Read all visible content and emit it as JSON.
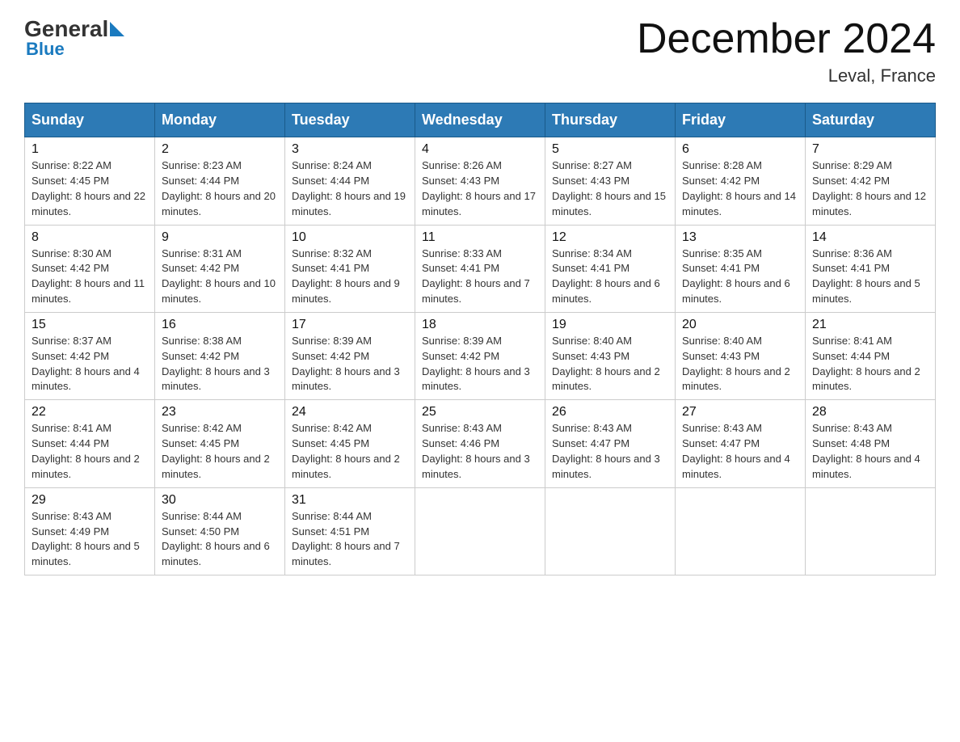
{
  "header": {
    "logo": {
      "general": "General",
      "blue": "Blue"
    },
    "month_title": "December 2024",
    "location": "Leval, France"
  },
  "weekdays": [
    "Sunday",
    "Monday",
    "Tuesday",
    "Wednesday",
    "Thursday",
    "Friday",
    "Saturday"
  ],
  "weeks": [
    [
      {
        "day": "1",
        "sunrise": "8:22 AM",
        "sunset": "4:45 PM",
        "daylight": "8 hours and 22 minutes."
      },
      {
        "day": "2",
        "sunrise": "8:23 AM",
        "sunset": "4:44 PM",
        "daylight": "8 hours and 20 minutes."
      },
      {
        "day": "3",
        "sunrise": "8:24 AM",
        "sunset": "4:44 PM",
        "daylight": "8 hours and 19 minutes."
      },
      {
        "day": "4",
        "sunrise": "8:26 AM",
        "sunset": "4:43 PM",
        "daylight": "8 hours and 17 minutes."
      },
      {
        "day": "5",
        "sunrise": "8:27 AM",
        "sunset": "4:43 PM",
        "daylight": "8 hours and 15 minutes."
      },
      {
        "day": "6",
        "sunrise": "8:28 AM",
        "sunset": "4:42 PM",
        "daylight": "8 hours and 14 minutes."
      },
      {
        "day": "7",
        "sunrise": "8:29 AM",
        "sunset": "4:42 PM",
        "daylight": "8 hours and 12 minutes."
      }
    ],
    [
      {
        "day": "8",
        "sunrise": "8:30 AM",
        "sunset": "4:42 PM",
        "daylight": "8 hours and 11 minutes."
      },
      {
        "day": "9",
        "sunrise": "8:31 AM",
        "sunset": "4:42 PM",
        "daylight": "8 hours and 10 minutes."
      },
      {
        "day": "10",
        "sunrise": "8:32 AM",
        "sunset": "4:41 PM",
        "daylight": "8 hours and 9 minutes."
      },
      {
        "day": "11",
        "sunrise": "8:33 AM",
        "sunset": "4:41 PM",
        "daylight": "8 hours and 7 minutes."
      },
      {
        "day": "12",
        "sunrise": "8:34 AM",
        "sunset": "4:41 PM",
        "daylight": "8 hours and 6 minutes."
      },
      {
        "day": "13",
        "sunrise": "8:35 AM",
        "sunset": "4:41 PM",
        "daylight": "8 hours and 6 minutes."
      },
      {
        "day": "14",
        "sunrise": "8:36 AM",
        "sunset": "4:41 PM",
        "daylight": "8 hours and 5 minutes."
      }
    ],
    [
      {
        "day": "15",
        "sunrise": "8:37 AM",
        "sunset": "4:42 PM",
        "daylight": "8 hours and 4 minutes."
      },
      {
        "day": "16",
        "sunrise": "8:38 AM",
        "sunset": "4:42 PM",
        "daylight": "8 hours and 3 minutes."
      },
      {
        "day": "17",
        "sunrise": "8:39 AM",
        "sunset": "4:42 PM",
        "daylight": "8 hours and 3 minutes."
      },
      {
        "day": "18",
        "sunrise": "8:39 AM",
        "sunset": "4:42 PM",
        "daylight": "8 hours and 3 minutes."
      },
      {
        "day": "19",
        "sunrise": "8:40 AM",
        "sunset": "4:43 PM",
        "daylight": "8 hours and 2 minutes."
      },
      {
        "day": "20",
        "sunrise": "8:40 AM",
        "sunset": "4:43 PM",
        "daylight": "8 hours and 2 minutes."
      },
      {
        "day": "21",
        "sunrise": "8:41 AM",
        "sunset": "4:44 PM",
        "daylight": "8 hours and 2 minutes."
      }
    ],
    [
      {
        "day": "22",
        "sunrise": "8:41 AM",
        "sunset": "4:44 PM",
        "daylight": "8 hours and 2 minutes."
      },
      {
        "day": "23",
        "sunrise": "8:42 AM",
        "sunset": "4:45 PM",
        "daylight": "8 hours and 2 minutes."
      },
      {
        "day": "24",
        "sunrise": "8:42 AM",
        "sunset": "4:45 PM",
        "daylight": "8 hours and 2 minutes."
      },
      {
        "day": "25",
        "sunrise": "8:43 AM",
        "sunset": "4:46 PM",
        "daylight": "8 hours and 3 minutes."
      },
      {
        "day": "26",
        "sunrise": "8:43 AM",
        "sunset": "4:47 PM",
        "daylight": "8 hours and 3 minutes."
      },
      {
        "day": "27",
        "sunrise": "8:43 AM",
        "sunset": "4:47 PM",
        "daylight": "8 hours and 4 minutes."
      },
      {
        "day": "28",
        "sunrise": "8:43 AM",
        "sunset": "4:48 PM",
        "daylight": "8 hours and 4 minutes."
      }
    ],
    [
      {
        "day": "29",
        "sunrise": "8:43 AM",
        "sunset": "4:49 PM",
        "daylight": "8 hours and 5 minutes."
      },
      {
        "day": "30",
        "sunrise": "8:44 AM",
        "sunset": "4:50 PM",
        "daylight": "8 hours and 6 minutes."
      },
      {
        "day": "31",
        "sunrise": "8:44 AM",
        "sunset": "4:51 PM",
        "daylight": "8 hours and 7 minutes."
      },
      null,
      null,
      null,
      null
    ]
  ]
}
